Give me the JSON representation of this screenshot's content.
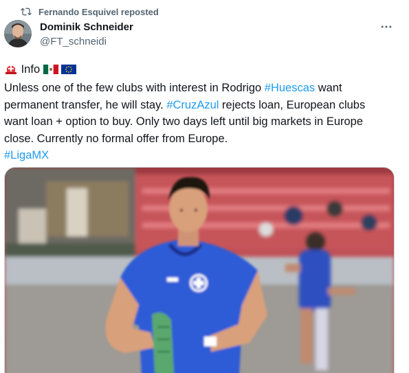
{
  "repost": {
    "icon": "repost-icon",
    "text": "Fernando Esquivel reposted"
  },
  "author": {
    "name": "Dominik Schneider",
    "handle": "@FT_schneidi",
    "avatar": "avatar-photo"
  },
  "more_icon": "more-horizontal-icon",
  "tweet": {
    "info_label": "Info",
    "emojis": [
      "siren-emoji",
      "mexico-flag-emoji",
      "eu-flag-emoji"
    ],
    "line1_pre": "Unless one of the few clubs with interest in Rodrigo ",
    "hashtag_huescas": "#Huescas",
    "line1_post": " want",
    "line2_pre": "permanent transfer, he will stay. ",
    "hashtag_cruzazul": "#CruzAzul",
    "line2_post": " rejects loan, European clubs",
    "line3": "want loan + option to buy. Only two days left until big markets in Europe",
    "line4": "close. Currently no formal offer from Europe.",
    "hashtag_ligamx": "#LigaMX"
  },
  "media": {
    "type": "photo",
    "description_icon": "football-player-photo"
  },
  "colors": {
    "link": "#1d9bf0",
    "text": "#0f1419",
    "secondary": "#536471",
    "jersey": "#2f5bd6"
  }
}
